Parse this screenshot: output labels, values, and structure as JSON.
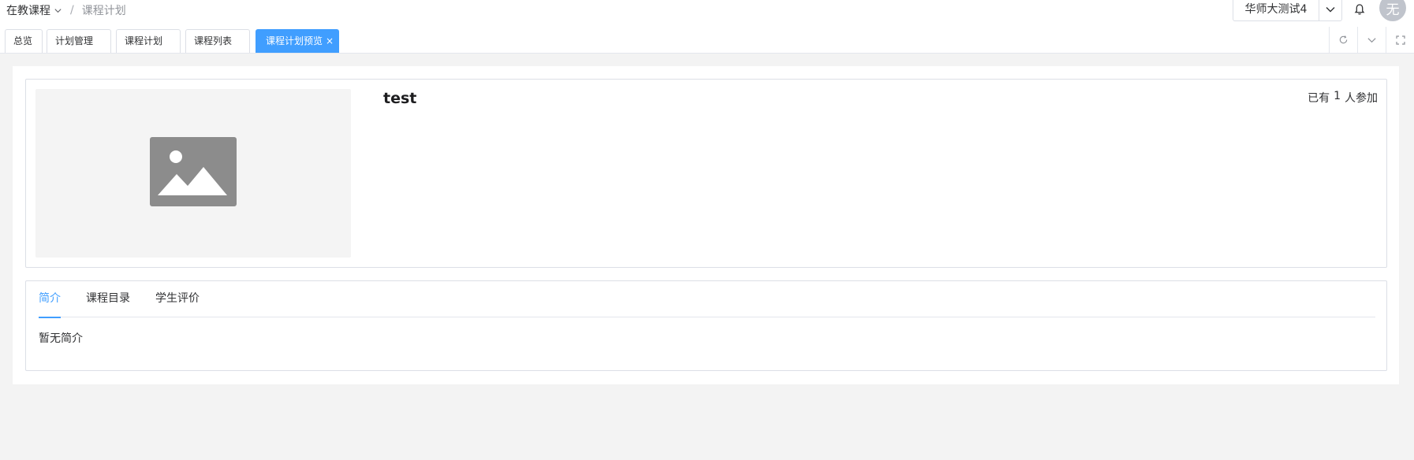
{
  "breadcrumb": {
    "first": "在教课程",
    "separator": "/",
    "current": "课程计划"
  },
  "header": {
    "tenant": "华师大测试4",
    "avatar": "无"
  },
  "tabs": [
    {
      "label": "总览"
    },
    {
      "label": "计划管理"
    },
    {
      "label": "课程计划"
    },
    {
      "label": "课程列表"
    },
    {
      "label": "课程计划预览",
      "active": true,
      "close": "×"
    }
  ],
  "course": {
    "title": "test",
    "joined_prefix": "已有",
    "joined_count": "1",
    "joined_suffix": "人参加"
  },
  "detail_tabs": [
    {
      "label": "简介",
      "active": true
    },
    {
      "label": "课程目录"
    },
    {
      "label": "学生评价"
    }
  ],
  "intro_text": "暂无简介",
  "colors": {
    "accent": "#409eff",
    "background": "#f3f3f3",
    "border": "#dcdfe6"
  },
  "icons": [
    "chevron-down-icon",
    "bell-icon",
    "refresh-icon",
    "fullscreen-icon",
    "image-placeholder-icon"
  ]
}
